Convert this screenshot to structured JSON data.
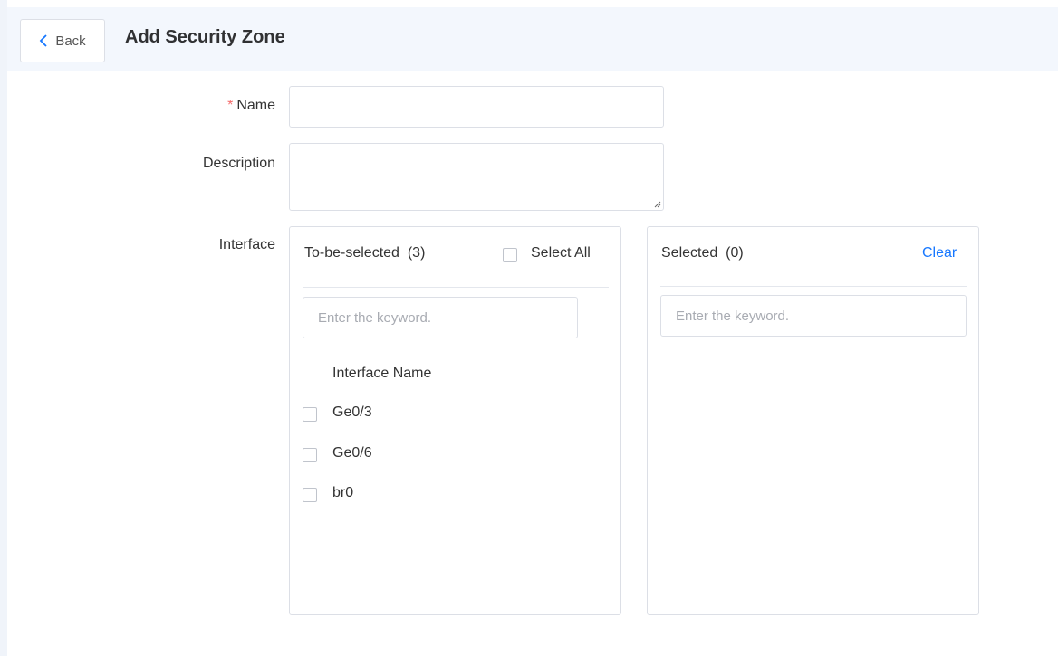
{
  "header": {
    "back_label": "Back",
    "title": "Add Security Zone"
  },
  "form": {
    "name_required_mark": "*",
    "name_label": "Name",
    "name_value": "",
    "description_label": "Description",
    "description_value": "",
    "interface_label": "Interface"
  },
  "left_panel": {
    "title": "To-be-selected",
    "count": "(3)",
    "select_all_label": "Select All",
    "search_placeholder": "Enter the keyword.",
    "column_header": "Interface Name",
    "items": [
      {
        "label": "Ge0/3"
      },
      {
        "label": "Ge0/6"
      },
      {
        "label": "br0"
      }
    ]
  },
  "right_panel": {
    "title": "Selected",
    "count": "(0)",
    "clear_label": "Clear",
    "search_placeholder": "Enter the keyword."
  },
  "colors": {
    "header_bg": "#f3f7fd",
    "required": "#f56c6c",
    "link": "#1677ff",
    "border": "#dcdfe6"
  }
}
